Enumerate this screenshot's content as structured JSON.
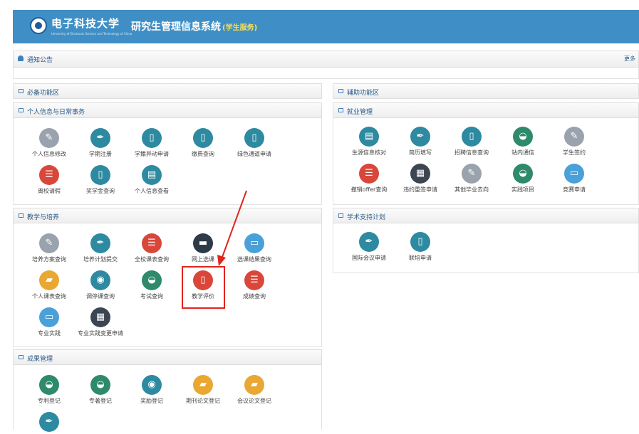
{
  "header": {
    "university": "电子科技大学",
    "university_en": "University of Electronic Science and Technology of China",
    "system_title": "研究生管理信息系统",
    "system_subtitle": "(学生服务)"
  },
  "notice": {
    "title": "通知公告",
    "more": "更多"
  },
  "sections": {
    "essential": "必备功能区",
    "personal": "个人信息与日常事务",
    "teaching": "教学与培养",
    "results": "成果管理",
    "auxiliary": "辅助功能区",
    "employment": "就业管理",
    "academic": "学术支持计划"
  },
  "personal_items": [
    {
      "label": "个人信息修改",
      "icon": "pencil-icon"
    },
    {
      "label": "学期注册",
      "icon": "pen-icon"
    },
    {
      "label": "学籍异动申请",
      "icon": "document-icon"
    },
    {
      "label": "缴费查询",
      "icon": "document-icon"
    },
    {
      "label": "绿色通道申请",
      "icon": "document-icon"
    },
    {
      "label": "离校请假",
      "icon": "form-icon"
    },
    {
      "label": "奖学金查询",
      "icon": "document-icon"
    },
    {
      "label": "个人信息查看",
      "icon": "id-card-icon"
    }
  ],
  "teaching_items": [
    {
      "label": "培养方案查询",
      "icon": "pencil-icon"
    },
    {
      "label": "培养计划提交",
      "icon": "pen-icon"
    },
    {
      "label": "全校课表查询",
      "icon": "form-icon"
    },
    {
      "label": "网上选课",
      "icon": "tray-icon"
    },
    {
      "label": "选课结果查询",
      "icon": "monitor-icon"
    },
    {
      "label": "个人课表查询",
      "icon": "folder-icon"
    },
    {
      "label": "调停课查询",
      "icon": "camera-icon"
    },
    {
      "label": "考试查询",
      "icon": "bowl-icon"
    },
    {
      "label": "教学评价",
      "icon": "phone-icon"
    },
    {
      "label": "成绩查询",
      "icon": "form-icon"
    },
    {
      "label": "专业实践",
      "icon": "monitor-icon"
    },
    {
      "label": "专业实践变更申请",
      "icon": "cards-icon"
    }
  ],
  "results_items": [
    {
      "label": "专利登记",
      "icon": "bowl-icon"
    },
    {
      "label": "专著登记",
      "icon": "bowl-icon"
    },
    {
      "label": "奖励登记",
      "icon": "camera-icon"
    },
    {
      "label": "期刊论文登记",
      "icon": "folder-icon"
    },
    {
      "label": "会议论文登记",
      "icon": "folder-icon"
    },
    {
      "label": "",
      "icon": "pen-icon"
    }
  ],
  "employment_items": [
    {
      "label": "生源信息核对",
      "icon": "id-card-icon"
    },
    {
      "label": "简历填写",
      "icon": "pen-icon"
    },
    {
      "label": "招聘信息查询",
      "icon": "document-icon"
    },
    {
      "label": "站内通信",
      "icon": "bowl-icon"
    },
    {
      "label": "学生签约",
      "icon": "pencil-icon"
    },
    {
      "label": "撤销offer查询",
      "icon": "form-icon"
    },
    {
      "label": "违约重签申请",
      "icon": "cards-icon"
    },
    {
      "label": "其他毕业去向",
      "icon": "pencil-icon"
    },
    {
      "label": "实践项目",
      "icon": "bowl-icon"
    },
    {
      "label": "竞赛申请",
      "icon": "monitor-icon"
    }
  ],
  "academic_items": [
    {
      "label": "国际会议申请",
      "icon": "pen-icon"
    },
    {
      "label": "联培申请",
      "icon": "document-icon"
    }
  ],
  "colors": {
    "header_bg": "#3f8fc6",
    "pencil-icon": "#9aa3ad",
    "pen-icon": "#2e8aa0",
    "document-icon": "#2e8aa0",
    "form-icon": "#d9473a",
    "id-card-icon": "#2e8aa0",
    "tray-icon": "#2d3a48",
    "monitor-icon": "#4aa0d8",
    "folder-icon": "#e9a832",
    "camera-icon": "#2e8aa0",
    "bowl-icon": "#2e8a6a",
    "phone-icon": "#d9473a",
    "cards-icon": "#3c4652",
    "highlight": "#e0251c"
  }
}
